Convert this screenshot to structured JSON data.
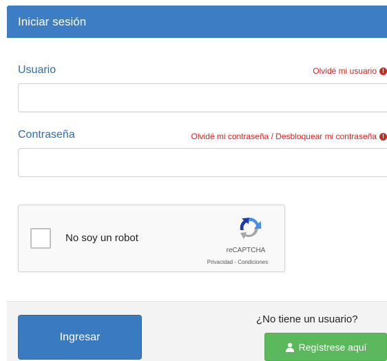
{
  "header": {
    "title": "Iniciar sesión"
  },
  "username": {
    "label": "Usuario",
    "forgot": "Olvidé mi usuario",
    "value": "",
    "placeholder": ""
  },
  "password": {
    "label": "Contraseña",
    "forgot": "Olvidé mi contraseña / Desbloquear mi contraseña",
    "value": "",
    "placeholder": ""
  },
  "recaptcha": {
    "label": "No soy un robot",
    "brand": "reCAPTCHA",
    "terms": "Privacidad - Condiciones",
    "icons": [
      "recaptcha-logo-icon"
    ]
  },
  "footer": {
    "login_label": "Ingresar",
    "no_user_text": "¿No tiene un usuario?",
    "register_label": "Regístrese aquí"
  },
  "icons": {
    "warning": "exclamation-circle-icon",
    "user": "user-icon"
  },
  "colors": {
    "header_bg": "#3c7dc4",
    "label_blue": "#2a6eb7",
    "forgot_red": "#d72020",
    "login_bg": "#3a7ac0",
    "register_bg": "#5cb85c"
  }
}
